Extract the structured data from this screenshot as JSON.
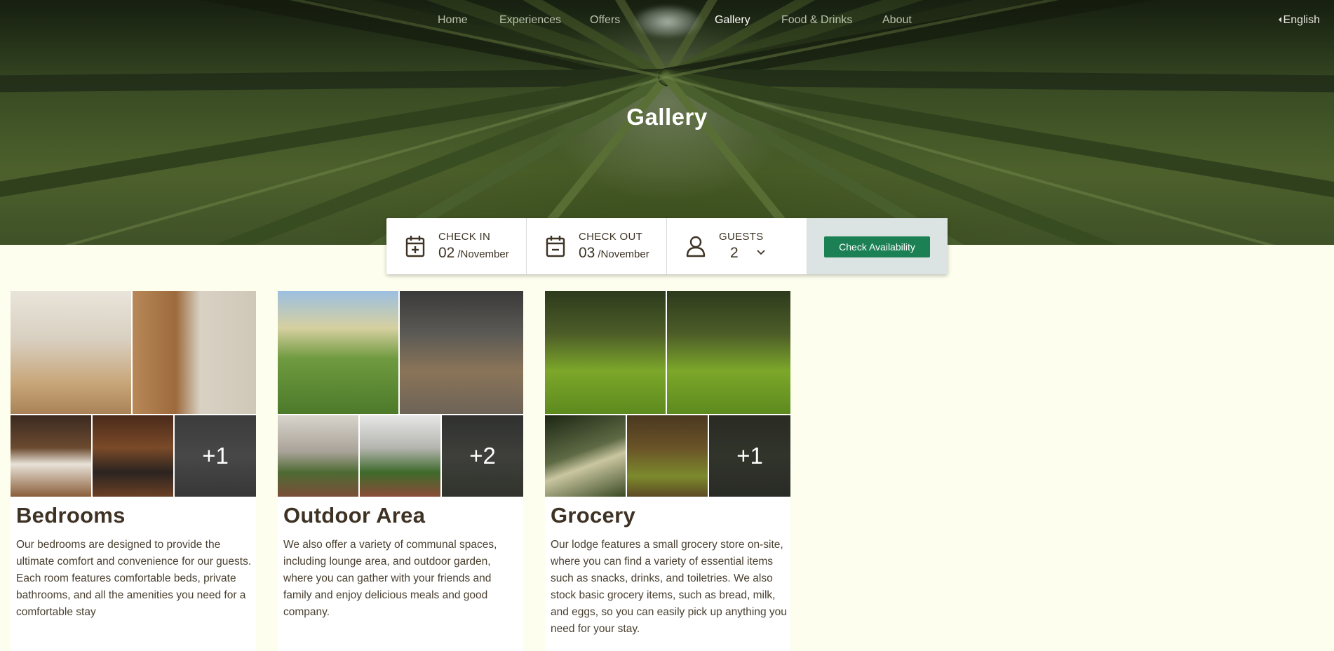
{
  "nav": {
    "items": [
      {
        "label": "Home",
        "active": false
      },
      {
        "label": "Experiences",
        "active": false
      },
      {
        "label": "Offers",
        "active": false
      },
      {
        "label": "Gallery",
        "active": true
      },
      {
        "label": "Food & Drinks",
        "active": false
      },
      {
        "label": "About",
        "active": false
      }
    ],
    "language": "English"
  },
  "hero": {
    "title": "Gallery"
  },
  "booking": {
    "check_in": {
      "label": "CHECK IN",
      "day": "02",
      "month": "/November",
      "icon": "calendar-plus-icon"
    },
    "check_out": {
      "label": "CHECK OUT",
      "day": "03",
      "month": "/November",
      "icon": "calendar-minus-icon"
    },
    "guests": {
      "label": "GUESTS",
      "value": "2",
      "icon": "user-icon"
    },
    "button_label": "Check Availability"
  },
  "gallery": [
    {
      "title": "Bedrooms",
      "description": "Our bedrooms are designed to provide the ultimate comfort and convenience for our guests. Each room features comfortable beds, private bathrooms, and all the amenities you need for a comfortable stay",
      "more_count": "+1"
    },
    {
      "title": "Outdoor Area",
      "description": "We also offer a variety of communal spaces, including lounge area, and outdoor garden, where you can gather with your friends and family and enjoy delicious meals and good company.",
      "more_count": "+2"
    },
    {
      "title": "Grocery",
      "description": "Our lodge features a small grocery store on-site, where you can find a variety of essential items such as snacks, drinks, and toiletries. We also stock basic grocery items, such as bread, milk, and eggs, so you can easily pick up anything you need for your stay.",
      "more_count": "+1"
    }
  ],
  "colors": {
    "page_background": "#fefeee",
    "accent_green": "#1b8054",
    "text_brown": "#3d3224",
    "nav_active": "#ffffff",
    "nav_inactive": "#b9c2ad"
  }
}
